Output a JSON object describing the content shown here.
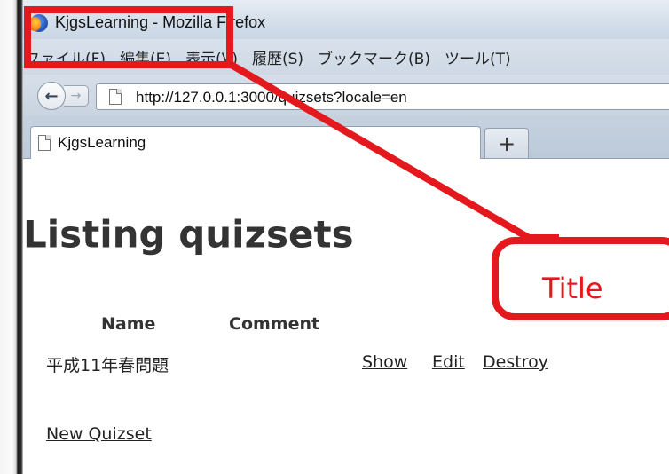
{
  "browser": {
    "window_title": "KjgsLearning - Mozilla Firefox",
    "menu": [
      "ファイル(F)",
      "編集(E)",
      "表示(V)",
      "履歴(S)",
      "ブックマーク(B)",
      "ツール(T)"
    ],
    "url": "http://127.0.0.1:3000/quizsets?locale=en",
    "tab_title": "KjgsLearning",
    "new_tab_label": "+",
    "back_label": "←",
    "forward_label": "→"
  },
  "page": {
    "heading": "Listing quizsets",
    "table": {
      "columns": [
        "Name",
        "Comment"
      ],
      "rows": [
        {
          "name": "平成11年春問題",
          "comment": "",
          "actions": [
            "Show",
            "Edit",
            "Destroy"
          ]
        }
      ]
    },
    "new_link": "New Quizset"
  },
  "annotation": {
    "label": "Title",
    "color": "#e3191d"
  }
}
